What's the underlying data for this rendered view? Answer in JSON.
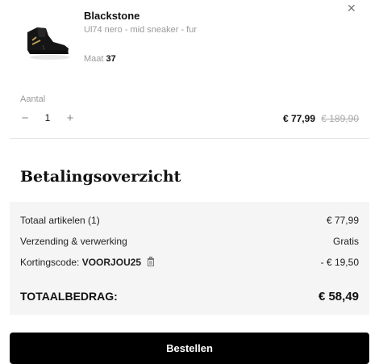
{
  "product": {
    "brand": "Blackstone",
    "description": "Ul74 nero - mid sneaker - fur",
    "size_label": "Maat",
    "size_value": "37",
    "image": "black-mid-sneaker",
    "close_icon": "close-icon"
  },
  "quantity": {
    "label": "Aantal",
    "value": "1",
    "minus": "−",
    "plus": "+"
  },
  "price": {
    "current": "€ 77,99",
    "original": "€ 189,90"
  },
  "summary": {
    "title": "Betalingsoverzicht",
    "rows": [
      {
        "label": "Totaal artikelen (1)",
        "value": "€ 77,99"
      },
      {
        "label": "Verzending & verwerking",
        "value": "Gratis"
      },
      {
        "label_prefix": "Kortingscode: ",
        "code": "VOORJOU25",
        "value": "- € 19,50",
        "icon": "trash-icon"
      }
    ],
    "total_label": "TOTAALBEDRAG:",
    "total_value": "€ 58,49"
  },
  "actions": {
    "order_label": "Bestellen"
  },
  "colors": {
    "button_bg": "#000000",
    "summary_bg": "#f5f5f5",
    "muted_text": "#9a9a9a"
  }
}
